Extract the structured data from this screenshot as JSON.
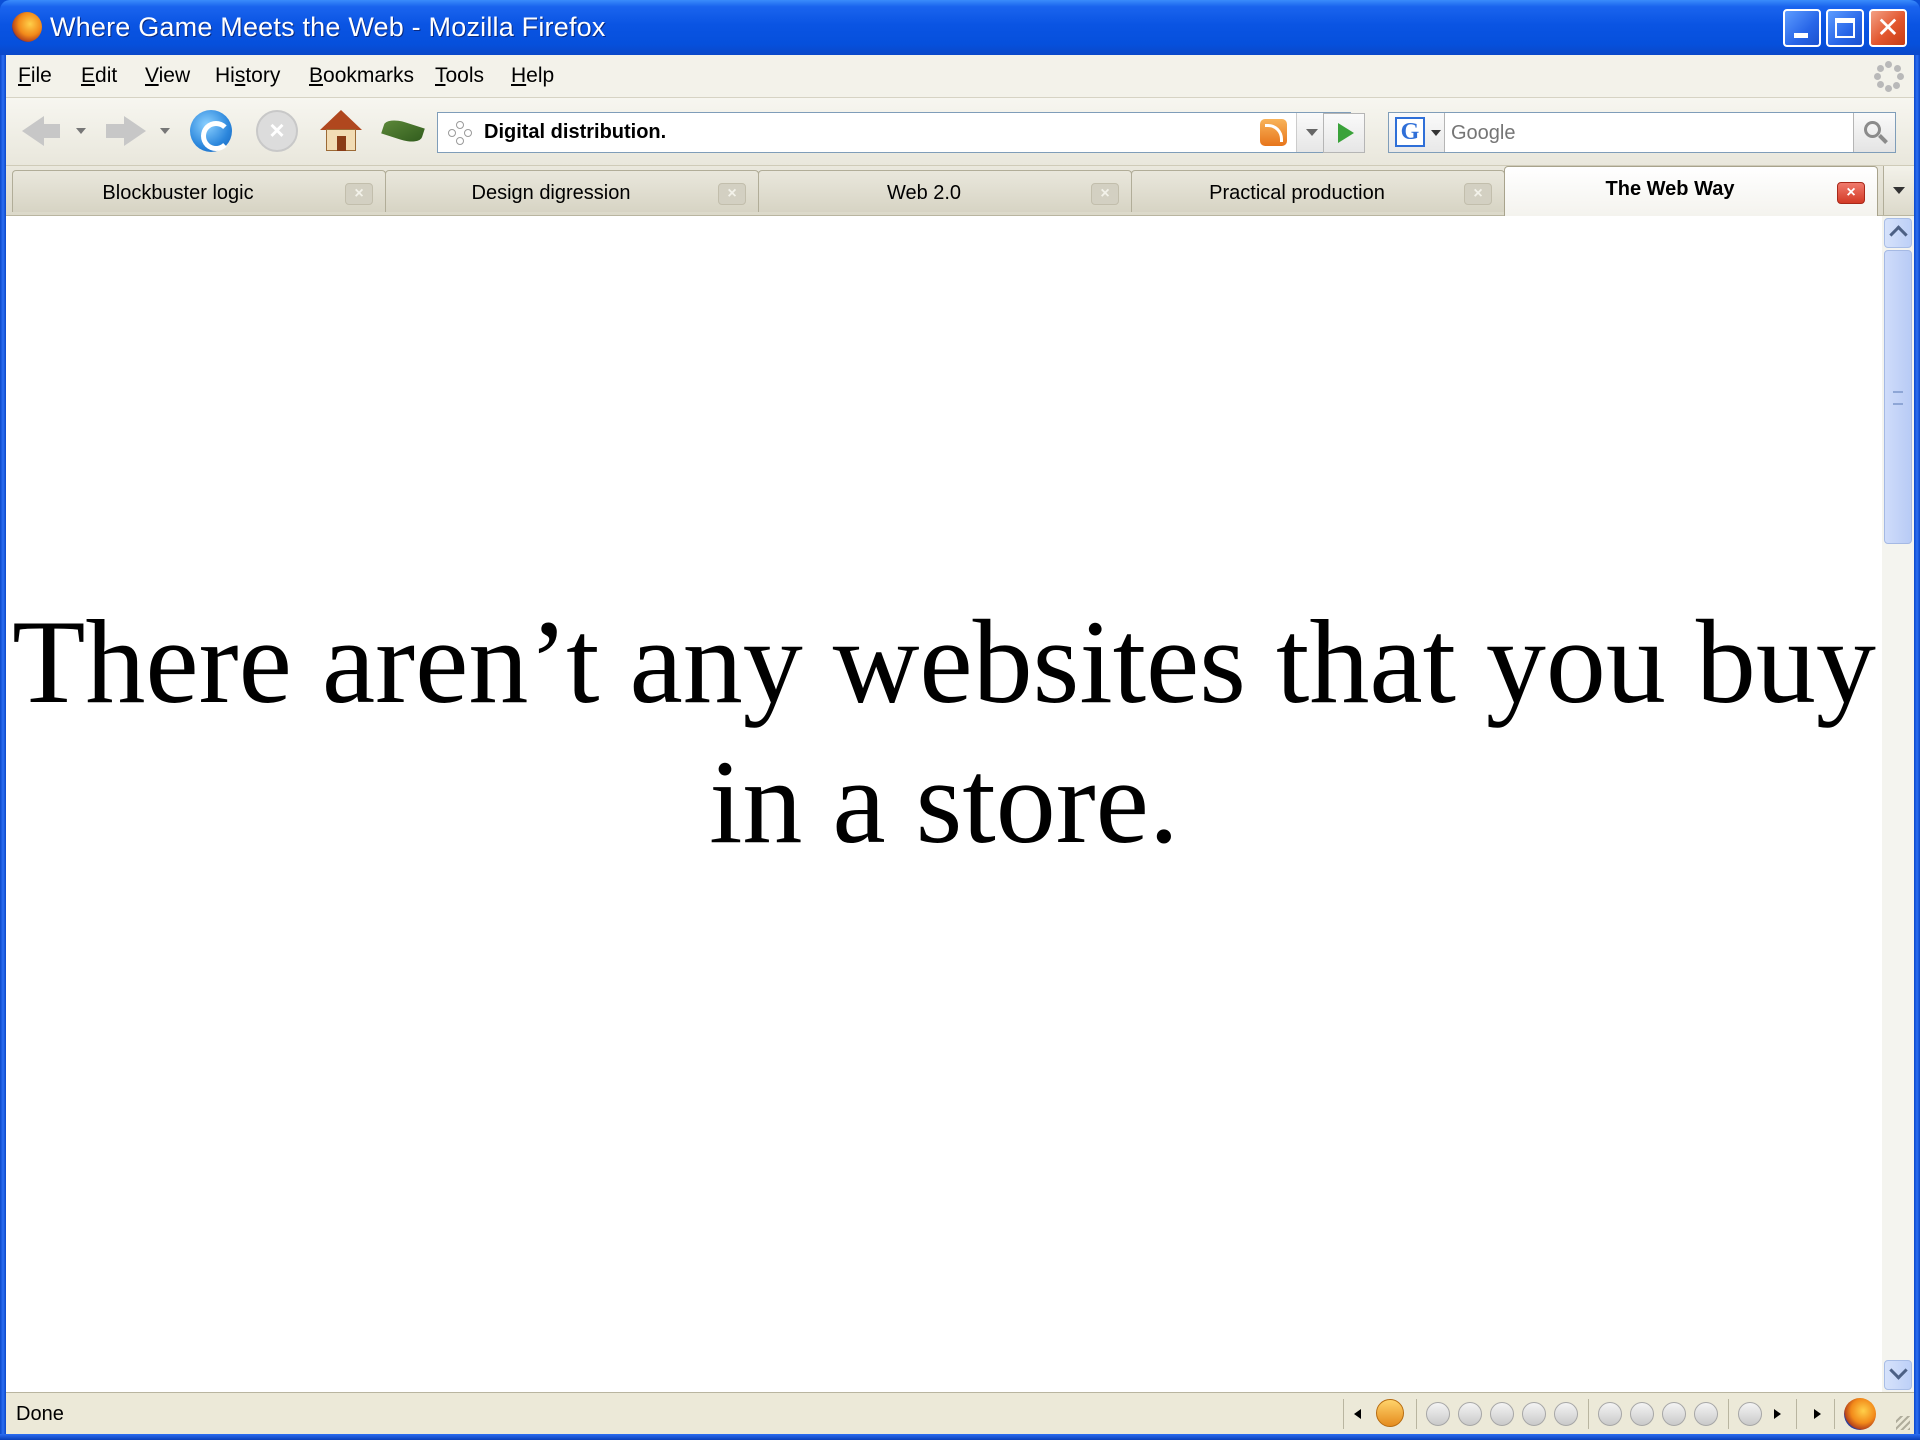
{
  "window": {
    "title": "Where Game Meets the Web - Mozilla Firefox"
  },
  "menu": {
    "file": {
      "accel": "F",
      "rest": "ile"
    },
    "edit": {
      "accel": "E",
      "rest": "dit"
    },
    "view": {
      "accel": "V",
      "rest": "iew"
    },
    "history": {
      "pre": "Hi",
      "accel": "s",
      "rest": "tory"
    },
    "bookmarks": {
      "accel": "B",
      "rest": "ookmarks"
    },
    "tools": {
      "accel": "T",
      "rest": "ools"
    },
    "help": {
      "accel": "H",
      "rest": "elp"
    }
  },
  "navbar": {
    "url": "Digital distribution.",
    "search_placeholder": "Google"
  },
  "tabs": [
    {
      "label": "Blockbuster logic",
      "active": false
    },
    {
      "label": "Design digression",
      "active": false
    },
    {
      "label": "Web 2.0",
      "active": false
    },
    {
      "label": "Practical production",
      "active": false
    },
    {
      "label": "The Web Way",
      "active": true
    }
  ],
  "content": {
    "slide_text": "There aren’t any websites that you buy in a store."
  },
  "status": {
    "text": "Done"
  },
  "colors": {
    "titlebar": "#0a54e3",
    "active_tab_close": "#d33a26",
    "chrome": "#ece9d8"
  }
}
